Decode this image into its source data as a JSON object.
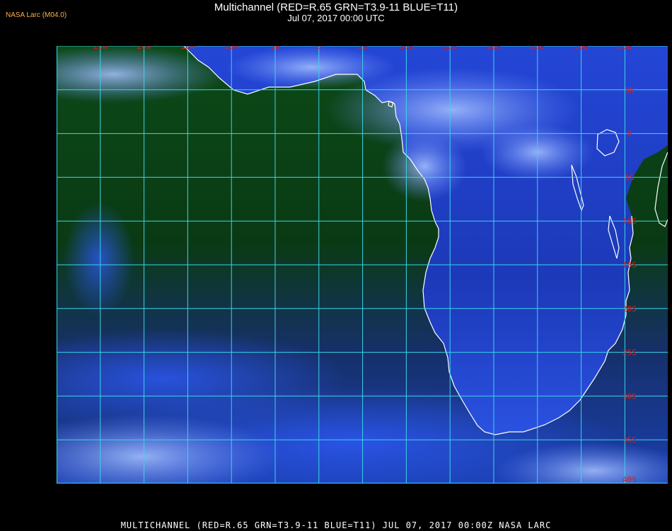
{
  "header": {
    "title": "Multichannel (RED=R.65 GRN=T3.9-11 BLUE=T11)",
    "subtitle": "Jul 07, 2017 00:00 UTC",
    "badge": "NASA Larc (M04.0)"
  },
  "footer": {
    "caption": "MULTICHANNEL (RED=R.65 GRN=T3.9-11 BLUE=T11) JUL 07, 2017 00:00Z   NASA LARC"
  },
  "map": {
    "longitude_labels": [
      "25W",
      "20W",
      "15W",
      "10W",
      "5W",
      "0",
      "5E",
      "10E",
      "15E",
      "20E",
      "25E",
      "30E",
      "35E"
    ],
    "latitude_labels": [
      "5N",
      "0",
      "5S",
      "10S",
      "15S",
      "20S",
      "25S",
      "30S",
      "35S",
      "40S"
    ],
    "colors": {
      "grid": "#39d6e6",
      "label": "#d81e1e",
      "coast": "#ffffff",
      "ocean": "#0b3d12",
      "land": "#1f3fc8",
      "cloud": "#9ab8ff"
    }
  }
}
